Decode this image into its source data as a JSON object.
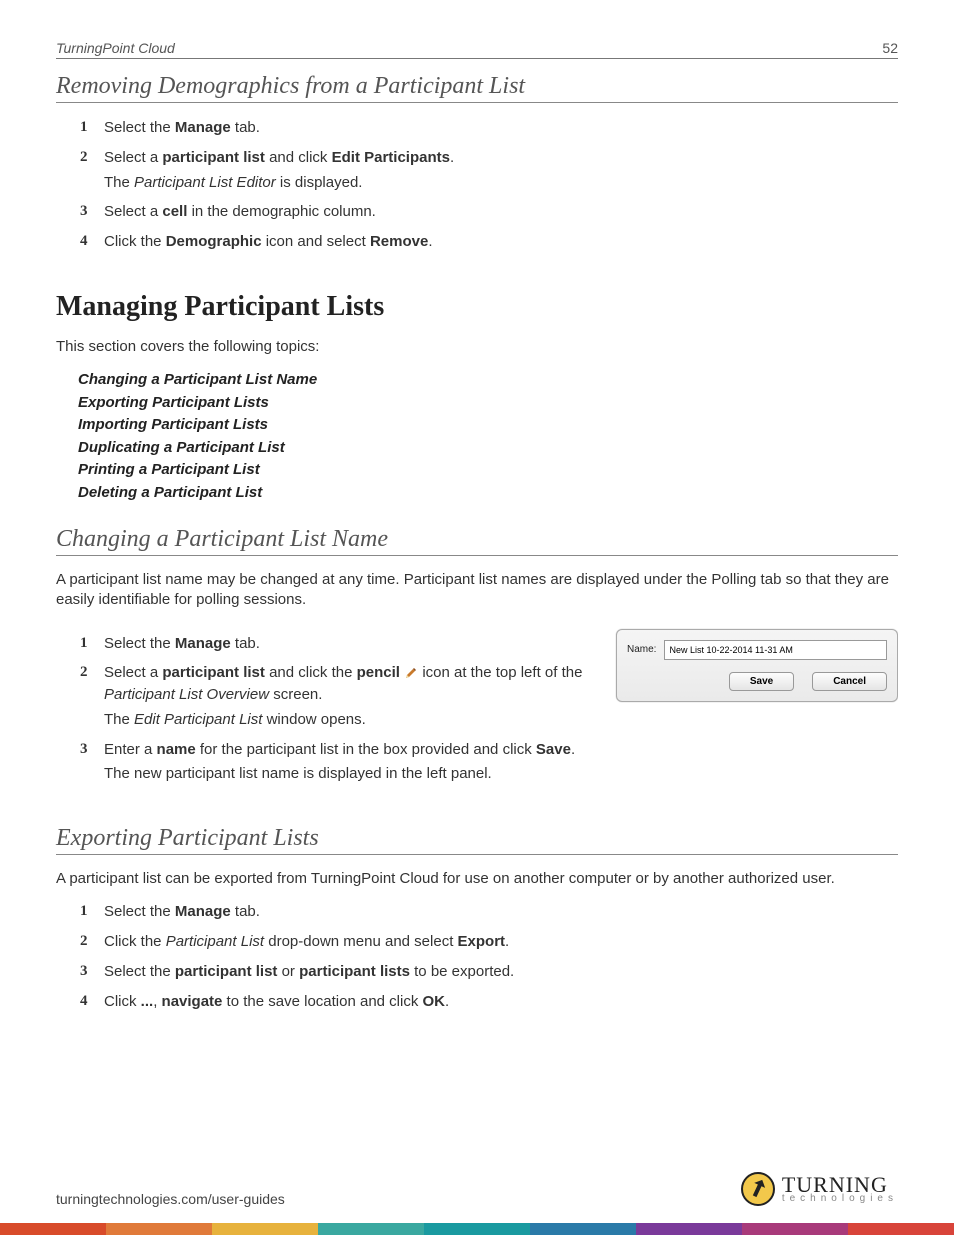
{
  "header": {
    "product": "TurningPoint Cloud",
    "page_number": "52"
  },
  "section1": {
    "title": "Removing Demographics from a Participant List",
    "steps": [
      {
        "num": "1",
        "html": "Select the <b>Manage</b> tab."
      },
      {
        "num": "2",
        "html": "Select a <b>participant list</b> and click <b>Edit Participants</b>.",
        "sub_html": "The <i>Participant List Editor</i> is displayed."
      },
      {
        "num": "3",
        "html": "Select a <b>cell</b> in the demographic column."
      },
      {
        "num": "4",
        "html": "Click the <b>Demographic</b> icon and select <b>Remove</b>."
      }
    ]
  },
  "section2": {
    "title": "Managing Participant Lists",
    "intro": "This section covers the following topics:",
    "topics": [
      "Changing a Participant List Name",
      "Exporting Participant Lists",
      "Importing Participant Lists",
      "Duplicating a Participant List",
      "Printing a Participant List",
      "Deleting a Participant List"
    ]
  },
  "section3": {
    "title": "Changing a Participant List Name",
    "intro": "A participant list name may be changed at any time. Participant list names are displayed under the Polling tab so that they are easily identifiable for polling sessions.",
    "dialog": {
      "name_label": "Name:",
      "name_value": "New List 10-22-2014 11-31 AM",
      "save_label": "Save",
      "cancel_label": "Cancel"
    },
    "steps": [
      {
        "num": "1",
        "html": "Select the <b>Manage</b> tab."
      },
      {
        "num": "2",
        "html": "Select a <b>participant list</b> and click the <b>pencil</b> {PENCIL} icon at the top left of the <i>Participant List Overview</i> screen.",
        "sub_html": "The <i>Edit Participant List</i> window opens."
      },
      {
        "num": "3",
        "html": "Enter a <b>name</b> for the participant list in the box provided and click <b>Save</b>.",
        "sub_html": "The new participant list name is displayed in the left panel."
      }
    ]
  },
  "section4": {
    "title": "Exporting Participant Lists",
    "intro": "A participant list can be exported from TurningPoint Cloud for use on another computer or by another authorized user.",
    "steps": [
      {
        "num": "1",
        "html": "Select the <b>Manage</b> tab."
      },
      {
        "num": "2",
        "html": "Click the <i>Participant List</i> drop-down menu and select <b>Export</b>."
      },
      {
        "num": "3",
        "html": "Select the <b>participant list</b> or <b>participant lists</b> to be exported."
      },
      {
        "num": "4",
        "html": "Click <b>...</b>, <b>navigate</b> to the save location and click <b>OK</b>."
      }
    ]
  },
  "footer": {
    "url": "turningtechnologies.com/user-guides",
    "logo_main": "TURNING",
    "logo_sub": "technologies"
  }
}
